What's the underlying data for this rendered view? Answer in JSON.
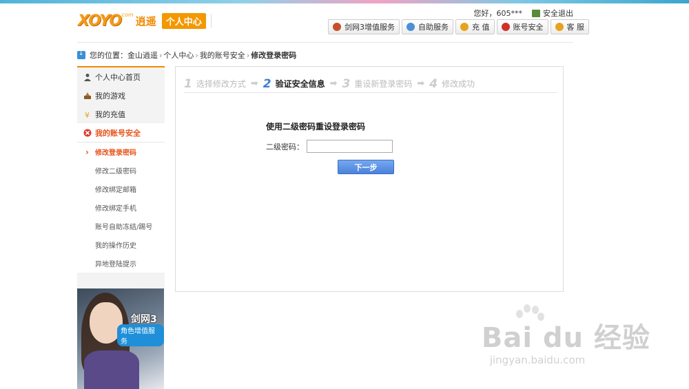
{
  "header": {
    "logo_text": "XOYO",
    "logo_com": ".com",
    "logo_cn": "逍遥",
    "logo_badge": "个人中心",
    "greeting": "您好，605***",
    "logout": "安全退出"
  },
  "top_buttons": [
    {
      "label": "剑网3增值服务",
      "icon": "jx3-shield-icon",
      "color": "#c8502a"
    },
    {
      "label": "自助服务",
      "icon": "person-icon",
      "color": "#4a90d6"
    },
    {
      "label": "充 值",
      "icon": "coins-icon",
      "color": "#e8a21b"
    },
    {
      "label": "账号安全",
      "icon": "shield-icon",
      "color": "#d0302a"
    },
    {
      "label": "客 服",
      "icon": "handshake-icon",
      "color": "#e8a21b"
    }
  ],
  "breadcrumb": {
    "prefix": "您的位置：",
    "items": [
      "金山逍遥",
      "个人中心",
      "我的账号安全"
    ],
    "current": "修改登录密码",
    "sep": "›"
  },
  "sidebar": {
    "items": [
      {
        "label": "个人中心首页",
        "icon": "user-icon"
      },
      {
        "label": "我的游戏",
        "icon": "game-icon"
      },
      {
        "label": "我的充值",
        "icon": "yen-icon"
      }
    ],
    "section": {
      "label": "我的账号安全",
      "icon": "security-icon"
    },
    "sub_items": [
      {
        "label": "修改登录密码",
        "active": true
      },
      {
        "label": "修改二级密码",
        "active": false
      },
      {
        "label": "修改绑定邮箱",
        "active": false
      },
      {
        "label": "修改绑定手机",
        "active": false
      },
      {
        "label": "账号自助冻结/踢号",
        "active": false
      },
      {
        "label": "我的操作历史",
        "active": false
      },
      {
        "label": "异地登陆提示",
        "active": false
      }
    ]
  },
  "promo": {
    "title": "剑网3",
    "tag": "角色增值服务"
  },
  "steps": [
    {
      "num": "1",
      "label": "选择修改方式",
      "active": false
    },
    {
      "num": "2",
      "label": "验证安全信息",
      "active": true
    },
    {
      "num": "3",
      "label": "重设新登录密码",
      "active": false
    },
    {
      "num": "4",
      "label": "修改成功",
      "active": false
    }
  ],
  "form": {
    "title": "使用二级密码重设登录密码",
    "field_label": "二级密码：",
    "field_value": "",
    "next_button": "下一步"
  },
  "watermark": {
    "big": "Bai du 经验",
    "small": "jingyan.baidu.com"
  },
  "colors": {
    "accent": "#f08a00",
    "active_text": "#e8541b",
    "button_blue": "#4a82dc"
  }
}
